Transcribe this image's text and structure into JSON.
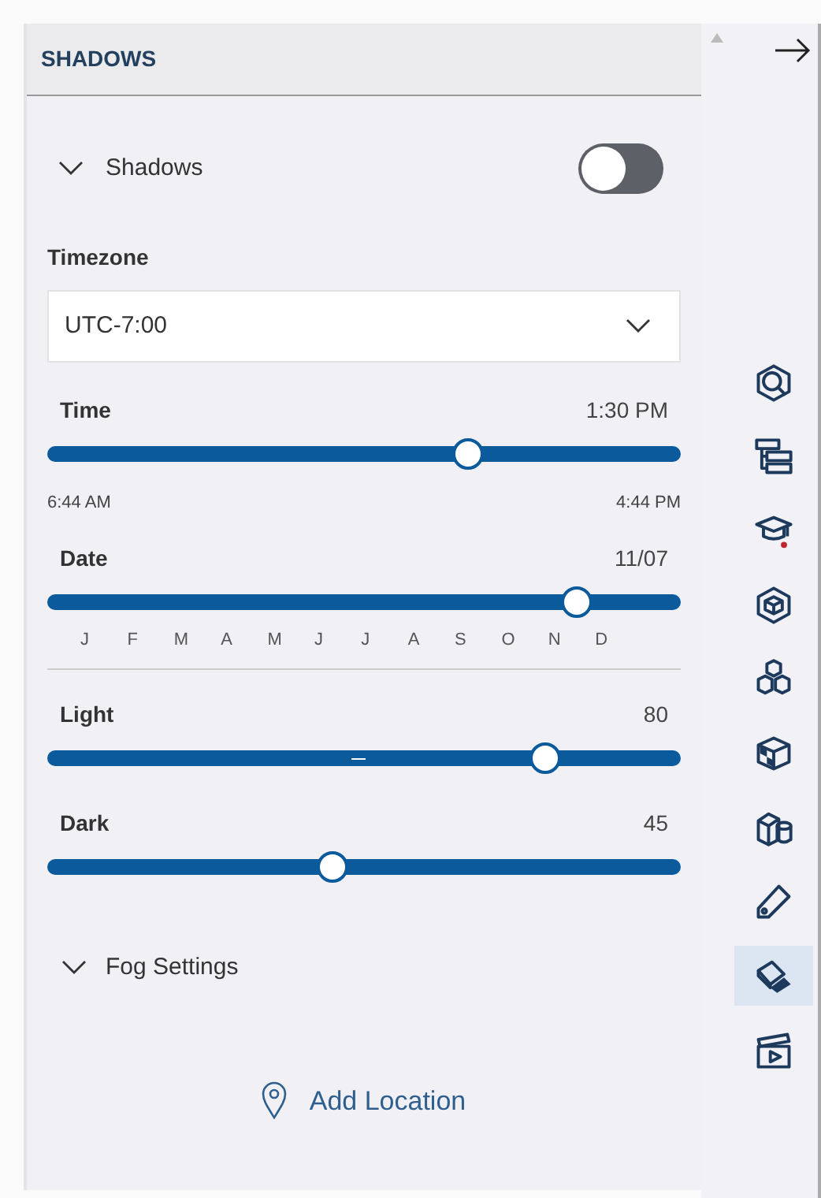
{
  "panel": {
    "title": "SHADOWS"
  },
  "shadows": {
    "label": "Shadows",
    "expanded": true,
    "on": false
  },
  "timezone": {
    "label": "Timezone",
    "value": "UTC-7:00"
  },
  "time": {
    "label": "Time",
    "reading": "1:30 PM",
    "level": 0.665,
    "min_label": "6:44 AM",
    "max_label": "4:44 PM"
  },
  "date": {
    "label": "Date",
    "reading": "11/07",
    "level": 0.835,
    "months": [
      "J",
      "F",
      "M",
      "A",
      "M",
      "J",
      "J",
      "A",
      "S",
      "O",
      "N",
      "D"
    ]
  },
  "light": {
    "label": "Light",
    "reading": "80",
    "level": 0.785
  },
  "dark": {
    "label": "Dark",
    "reading": "45",
    "level": 0.45
  },
  "fog": {
    "label": "Fog Settings",
    "expanded": false
  },
  "add_location": {
    "label": "Add Location"
  },
  "rail": [
    {
      "kind": "search",
      "selected": false
    },
    {
      "kind": "tree",
      "selected": false
    },
    {
      "kind": "learn",
      "selected": false
    },
    {
      "kind": "object",
      "selected": false
    },
    {
      "kind": "cubes",
      "selected": false
    },
    {
      "kind": "texture",
      "selected": false
    },
    {
      "kind": "shapes",
      "selected": false
    },
    {
      "kind": "tag",
      "selected": false
    },
    {
      "kind": "shadow",
      "selected": true
    },
    {
      "kind": "animation",
      "selected": false
    }
  ]
}
